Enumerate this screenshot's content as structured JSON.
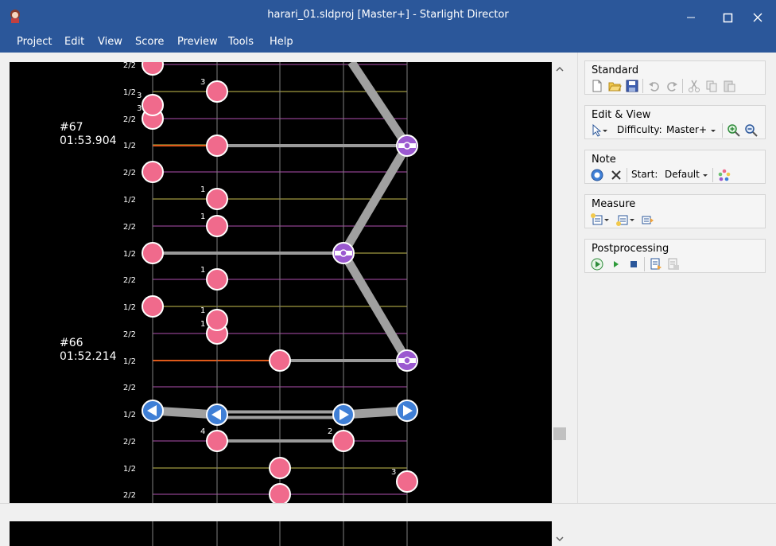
{
  "window": {
    "title": "harari_01.sldproj [Master+] - Starlight Director"
  },
  "menu": [
    "Project",
    "Edit",
    "View",
    "Score",
    "Preview",
    "Tools",
    "Help"
  ],
  "measures": [
    {
      "id": "#67",
      "time": "01:53.904"
    },
    {
      "id": "#66",
      "time": "01:52.214"
    }
  ],
  "beats": [
    "2/2",
    "1/2",
    "2/2",
    "1/2",
    "2/2",
    "1/2",
    "2/2",
    "1/2",
    "2/2",
    "1/2",
    "2/2",
    "1/2",
    "2/2",
    "1/2",
    "2/2",
    "1/2",
    "2/2"
  ],
  "note_numbers": [
    "3",
    "3",
    "3",
    "1",
    "1",
    "1",
    "1",
    "1",
    "4",
    "2",
    "3"
  ],
  "panel": {
    "standard": {
      "title": "Standard"
    },
    "edit_view": {
      "title": "Edit & View",
      "difficulty_label": "Difficulty:",
      "difficulty_value": "Master+"
    },
    "note": {
      "title": "Note",
      "start_label": "Start:",
      "start_value": "Default"
    },
    "measure": {
      "title": "Measure"
    },
    "postprocessing": {
      "title": "Postprocessing"
    }
  },
  "colors": {
    "titlebar": "#2b579a",
    "note_pink": "#f06a8c",
    "note_purple": "#9b59d0",
    "note_blue": "#3f7fd6",
    "lane": "#808080"
  }
}
